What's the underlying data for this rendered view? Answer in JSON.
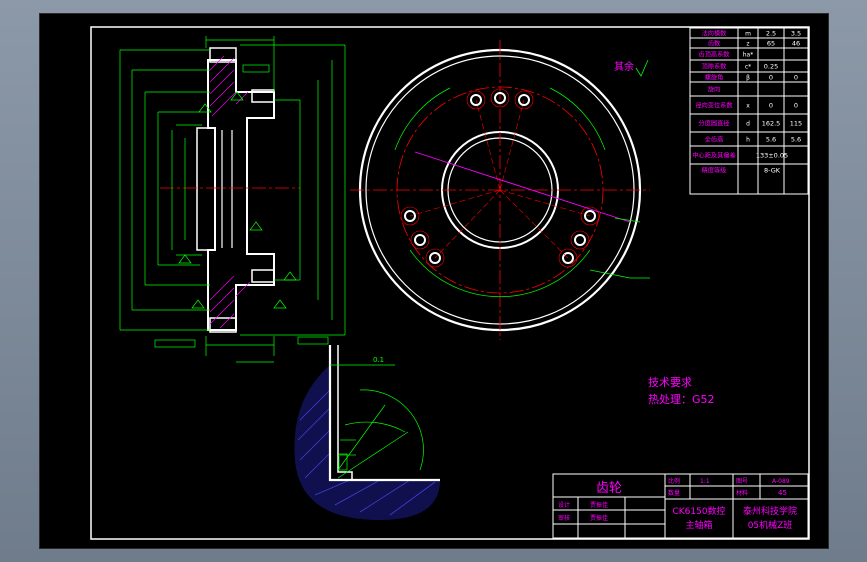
{
  "param_table": {
    "rows": [
      {
        "label": "法向模数",
        "sym": "m",
        "v1": "2.5",
        "v2": "3.5"
      },
      {
        "label": "齿数",
        "sym": "z",
        "v1": "65",
        "v2": "46"
      },
      {
        "label": "齿顶高系数",
        "sym": "ha*",
        "v1": "",
        "v2": ""
      },
      {
        "label": "顶隙系数",
        "sym": "c*",
        "v1": "0.25",
        "v2": ""
      },
      {
        "label": "螺旋角",
        "sym": "β",
        "v1": "0",
        "v2": "0"
      },
      {
        "label": "旋向",
        "sym": "",
        "v1": "",
        "v2": ""
      },
      {
        "label": "径向变位系数",
        "sym": "x",
        "v1": "0",
        "v2": "0"
      },
      {
        "label": "分度圆直径",
        "sym": "d",
        "v1": "162.5",
        "v2": "115"
      },
      {
        "label": "全齿高",
        "sym": "h",
        "v1": "5.6",
        "v2": "5.6"
      },
      {
        "label": "中心距及其偏差",
        "sym": "",
        "v1": "133±0.05",
        "v2": ""
      },
      {
        "label": "精度等级",
        "sym": "",
        "v1": "8-GK",
        "v2": ""
      }
    ]
  },
  "annotations": {
    "rest_roughness": "其余",
    "tech_title": "技术要求",
    "tech_line": "热处理：G52",
    "section_dim": "0.1"
  },
  "title_block": {
    "part_name": "齿轮",
    "scale_label": "比例",
    "scale_value": "1:1",
    "qty_label": "数量",
    "drawing_no_label": "图号",
    "drawing_no": "A-089",
    "material_label": "材料",
    "material": "45",
    "designer_label": "设计",
    "designer": "贾振佳",
    "checker_label": "审核",
    "checker": "贾振佳",
    "assembly": "CK6150数控主轴箱",
    "assembly_line1": "CK6150数控",
    "assembly_line2": "主轴箱",
    "school_line1": "泰州科技学院",
    "school_line2": "05机械Z班"
  },
  "colors": {
    "background": "#000000",
    "outline": "#ffffff",
    "dimension": "#00ff00",
    "text": "#ff00ff",
    "centerline": "#ff0000",
    "hatch": "#3030c0",
    "frame": "#7a8796"
  }
}
